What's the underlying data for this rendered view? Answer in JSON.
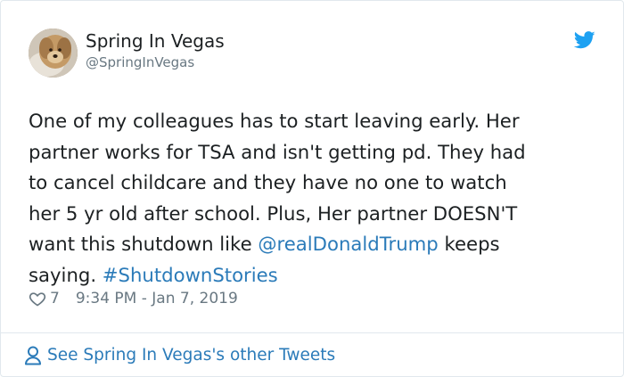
{
  "author": {
    "display_name": "Spring In Vegas",
    "handle": "@SpringInVegas",
    "avatar_icon": "dog-avatar"
  },
  "brand_icon": "twitter-bird-icon",
  "colors": {
    "link": "#2b7bb9",
    "bird": "#1da1f2",
    "meta": "#697882",
    "text": "#1c2022"
  },
  "tweet": {
    "line1": "One of my colleagues has to start leaving early. Her",
    "line2": "partner works for TSA and isn't getting pd. They had",
    "line3": "to cancel childcare and they have no one to watch",
    "line4": "her 5 yr old after school. Plus, Her partner DOESN'T",
    "line5_before": "want this shutdown like ",
    "mention": "@realDonaldTrump",
    "line5_after": " keeps",
    "line6_before": "saying. ",
    "hashtag": "#ShutdownStories"
  },
  "meta": {
    "like_count": "7",
    "timestamp": "9:34 PM - Jan 7, 2019"
  },
  "footer": {
    "label": "See Spring In Vegas's other Tweets"
  }
}
